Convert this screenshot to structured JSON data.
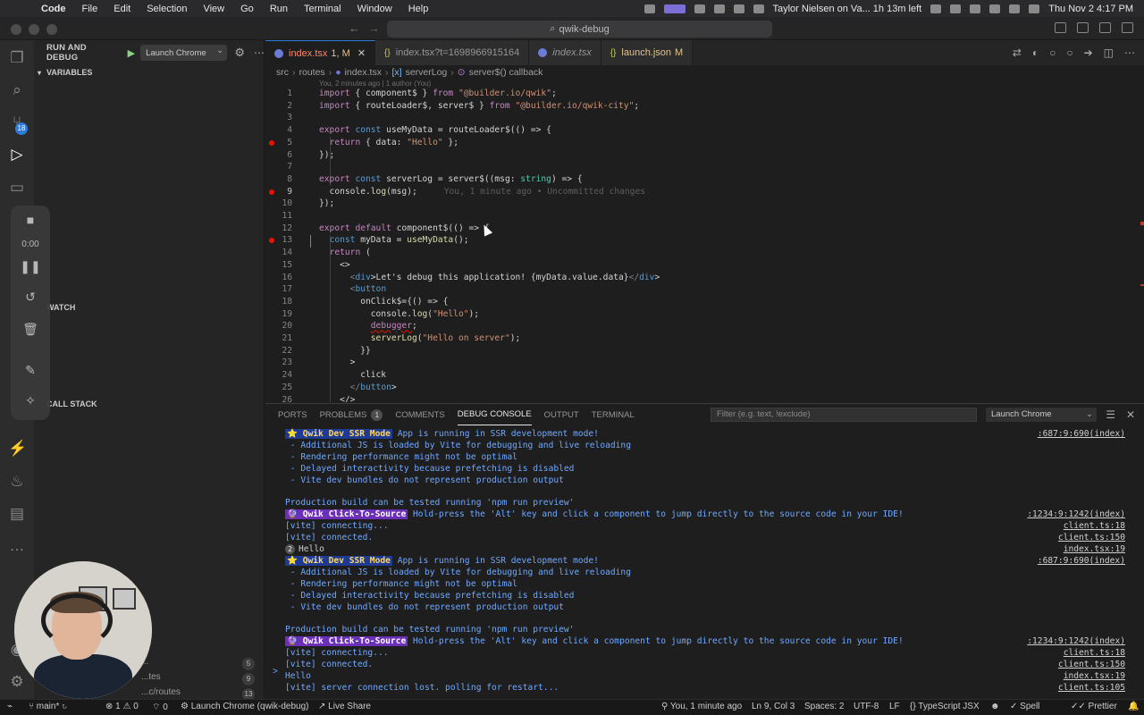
{
  "menubar": {
    "items": [
      "Code",
      "File",
      "Edit",
      "Selection",
      "View",
      "Go",
      "Run",
      "Terminal",
      "Window",
      "Help"
    ],
    "battery_status": "Taylor Nielsen on Va... 1h 13m left",
    "clock": "Thu Nov 2  4:17 PM"
  },
  "window": {
    "command_center": "qwik-debug"
  },
  "activity_bar": {
    "icons": [
      "files-icon",
      "search-icon",
      "source-control-icon",
      "run-debug-icon",
      "remote-explorer-icon",
      "extensions-icon"
    ],
    "source_control_badge": "18"
  },
  "debug_toolbar": {
    "timer": "0:00"
  },
  "sidebar": {
    "title": "RUN AND DEBUG",
    "config": "Launch Chrome",
    "sections": {
      "variables": "VARIABLES",
      "watch": "WATCH",
      "call_stack": "CALL STACK"
    },
    "call_stack_items": [
      {
        "label": "...",
        "count": "5"
      },
      {
        "label": "...tes",
        "count": "9"
      },
      {
        "label": "...c/routes",
        "count": "13"
      }
    ]
  },
  "tabs": [
    {
      "label": "index.tsx",
      "suffix": "1, M",
      "active": true
    },
    {
      "label": "index.tsx?t=1698966915164",
      "suffix": "",
      "active": false
    },
    {
      "label": "index.tsx",
      "suffix": "",
      "active": false
    },
    {
      "label": "launch.json",
      "suffix": "M",
      "active": false
    }
  ],
  "breadcrumbs": [
    "src",
    "routes",
    "index.tsx",
    "serverLog",
    "server$() callback"
  ],
  "blame_header": "You, 2 minutes ago | 1 author (You)",
  "inline_blame": "You, 1 minute ago • Uncommitted changes",
  "code_lines": [
    "import { component$ } from \"@builder.io/qwik\";",
    "import { routeLoader$, server$ } from \"@builder.io/qwik-city\";",
    "",
    "export const useMyData = routeLoader$(() => {",
    "  return { data: \"Hello\" };",
    "});",
    "",
    "export const serverLog = server$((msg: string) => {",
    "  console.log(msg);",
    "});",
    "",
    "export default component$(() => {",
    "  const myData = useMyData();",
    "  return (",
    "    <>",
    "      <div>Let's debug this application! {myData.value.data}</div>",
    "      <button",
    "        onClick$={() => {",
    "          console.log(\"Hello\");",
    "          debugger;",
    "          serverLog(\"Hello on server\");",
    "        }}",
    "      >",
    "        click",
    "      </button>",
    "    </>"
  ],
  "panel": {
    "tabs": [
      "PORTS",
      "PROBLEMS",
      "COMMENTS",
      "DEBUG CONSOLE",
      "OUTPUT",
      "TERMINAL"
    ],
    "problems_count": "1",
    "filter_placeholder": "Filter (e.g. text, !exclude)",
    "config": "Launch Chrome"
  },
  "console_lines": [
    {
      "badge": "⭐️ Qwik Dev SSR Mode",
      "badge_type": "y",
      "text": " App is running in SSR development mode!",
      "src": ":687:9:690(index)"
    },
    {
      "text": " - Additional JS is loaded by Vite for debugging and live reloading",
      "src": ""
    },
    {
      "text": " - Rendering performance might not be optimal",
      "src": ""
    },
    {
      "text": " - Delayed interactivity because prefetching is disabled",
      "src": ""
    },
    {
      "text": " - Vite dev bundles do not represent production output",
      "src": ""
    },
    {
      "text": "",
      "src": ""
    },
    {
      "text": "Production build can be tested running 'npm run preview'",
      "src": ""
    },
    {
      "badge": "🔮 Qwik Click-To-Source",
      "badge_type": "p",
      "text": " Hold-press the 'Alt' key and click a component to jump directly to the source code in your IDE!",
      "src": ":1234:9:1242(index)"
    },
    {
      "text": "[vite] connecting...",
      "src": "client.ts:18"
    },
    {
      "text": "[vite] connected.",
      "src": "client.ts:150"
    },
    {
      "count": "2",
      "text": "Hello",
      "src": "index.tsx:19"
    },
    {
      "badge": "⭐️ Qwik Dev SSR Mode",
      "badge_type": "y",
      "text": " App is running in SSR development mode!",
      "src": ":687:9:690(index)"
    },
    {
      "text": " - Additional JS is loaded by Vite for debugging and live reloading",
      "src": ""
    },
    {
      "text": " - Rendering performance might not be optimal",
      "src": ""
    },
    {
      "text": " - Delayed interactivity because prefetching is disabled",
      "src": ""
    },
    {
      "text": " - Vite dev bundles do not represent production output",
      "src": ""
    },
    {
      "text": "",
      "src": ""
    },
    {
      "text": "Production build can be tested running 'npm run preview'",
      "src": ""
    },
    {
      "badge": "🔮 Qwik Click-To-Source",
      "badge_type": "p",
      "text": " Hold-press the 'Alt' key and click a component to jump directly to the source code in your IDE!",
      "src": ":1234:9:1242(index)"
    },
    {
      "text": "[vite] connecting...",
      "src": "client.ts:18"
    },
    {
      "text": "[vite] connected.",
      "src": "client.ts:150"
    },
    {
      "text": "Hello",
      "src": "index.tsx:19"
    },
    {
      "text": "[vite] server connection lost. polling for restart...",
      "src": "client.ts:105"
    }
  ],
  "console_prompt": ">",
  "status": {
    "branch": "main*",
    "errors": "1",
    "warnings": "0",
    "ports": "0",
    "debug_config": "Launch Chrome (qwik-debug)",
    "live_share": "Live Share",
    "blame": "You, 1 minute ago",
    "position": "Ln 9, Col 3",
    "spaces": "Spaces: 2",
    "encoding": "UTF-8",
    "eol": "LF",
    "language": "TypeScript JSX",
    "spell": "Spell",
    "prettier": "Prettier"
  },
  "colors": {
    "accent": "#2f7bd9",
    "breakpoint": "#e51400",
    "console_text": "#6fa8ff"
  }
}
